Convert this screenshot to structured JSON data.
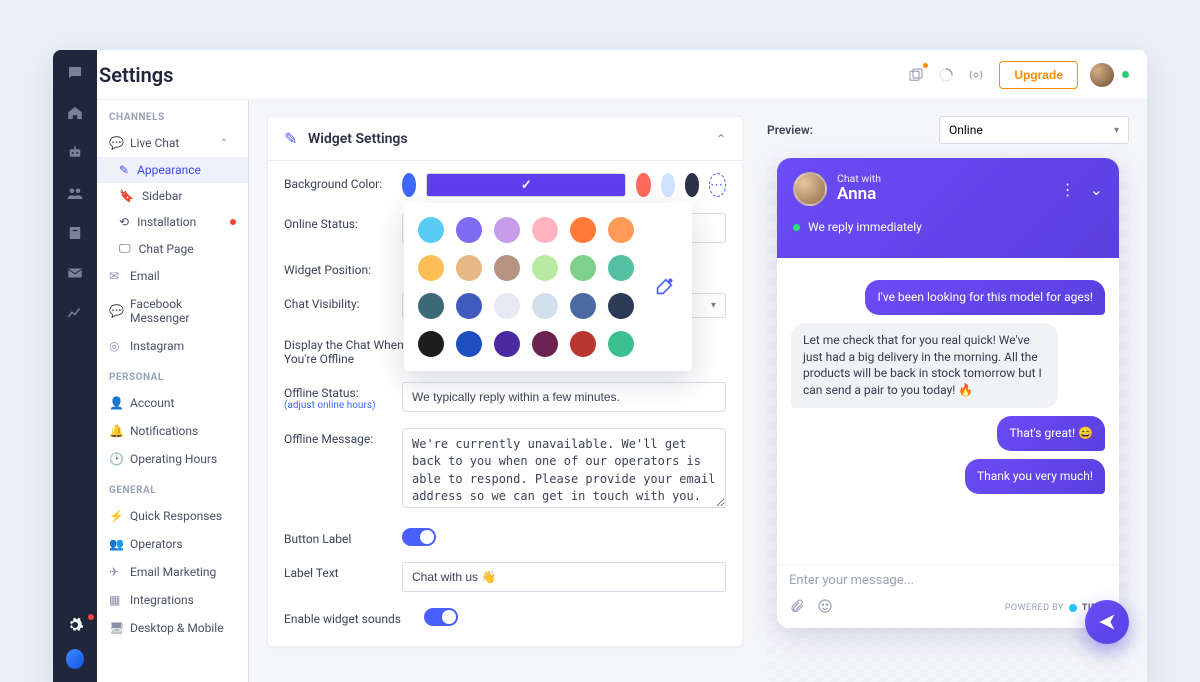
{
  "header": {
    "title": "Settings",
    "upgrade_label": "Upgrade"
  },
  "rail": {
    "icons": [
      "chat",
      "home",
      "bot",
      "people",
      "book",
      "mail",
      "chart"
    ]
  },
  "sidebar": {
    "sections": [
      {
        "label": "CHANNELS",
        "items": [
          {
            "label": "Live Chat",
            "icon": "chat-bubble",
            "expanded": true,
            "sub": [
              {
                "label": "Appearance",
                "icon": "brush",
                "active": true
              },
              {
                "label": "Sidebar",
                "icon": "bookmark"
              },
              {
                "label": "Installation",
                "icon": "link",
                "badge": true
              },
              {
                "label": "Chat Page",
                "icon": "monitor"
              }
            ]
          },
          {
            "label": "Email",
            "icon": "mail"
          },
          {
            "label": "Facebook Messenger",
            "icon": "messenger"
          },
          {
            "label": "Instagram",
            "icon": "instagram"
          }
        ]
      },
      {
        "label": "PERSONAL",
        "items": [
          {
            "label": "Account",
            "icon": "user"
          },
          {
            "label": "Notifications",
            "icon": "bell"
          },
          {
            "label": "Operating Hours",
            "icon": "clock"
          }
        ]
      },
      {
        "label": "GENERAL",
        "items": [
          {
            "label": "Quick Responses",
            "icon": "bolt"
          },
          {
            "label": "Operators",
            "icon": "people"
          },
          {
            "label": "Email Marketing",
            "icon": "send"
          },
          {
            "label": "Integrations",
            "icon": "grid"
          },
          {
            "label": "Desktop & Mobile",
            "icon": "devices"
          }
        ]
      }
    ]
  },
  "panel": {
    "title": "Widget Settings",
    "labels": {
      "bg_color": "Background Color:",
      "online_status": "Online Status:",
      "widget_position": "Widget Position:",
      "chat_visibility": "Chat Visibility:",
      "display_offline": "Display the Chat When You're Offline",
      "offline_status": "Offline Status:",
      "offline_status_hint": "(adjust online hours)",
      "offline_message": "Offline Message:",
      "button_label": "Button Label",
      "label_text": "Label Text",
      "enable_sounds": "Enable widget sounds"
    },
    "main_colors": [
      "#3d67ff",
      "#5f3fed",
      "#ff6a5c",
      "#cfe4ff",
      "#2b3245"
    ],
    "offline_status_value": "We typically reply within a few minutes.",
    "offline_message_value": "We're currently unavailable. We'll get back to you when one of our operators is able to respond. Please provide your email address so we can get in touch with you.",
    "label_text_value": "Chat with us 👋",
    "selected_color_index": 1,
    "popover_colors": [
      "#57cdf5",
      "#7d6cf1",
      "#c59bea",
      "#ffb3be",
      "#ff7a36",
      "#ff9a58",
      "#ffbe55",
      "#e7b784",
      "#b69283",
      "#b8eaa1",
      "#7fcf8d",
      "#52c0a1",
      "#3b6a76",
      "#3f5bbf",
      "#e6e9f3",
      "#d2e0ee",
      "#4a6aa0",
      "#2c3a56",
      "#1d1d1d",
      "#1f4fbf",
      "#4a2a9e",
      "#6a2450",
      "#b8382f",
      "#3bbf8f"
    ]
  },
  "preview": {
    "label": "Preview:",
    "status_select": "Online",
    "widget": {
      "subtitle": "Chat with",
      "operator_name": "Anna",
      "status_line": "We reply immediately",
      "messages": [
        {
          "from": "me",
          "text": "I've been looking for this model for ages!"
        },
        {
          "from": "op",
          "text": "Let me check that for you real quick! We've just had a big delivery in the morning. All the products will be back in stock tomorrow but I can send a pair to you today! 🔥"
        },
        {
          "from": "me",
          "text": "That's great! 😄"
        },
        {
          "from": "me",
          "text": "Thank you very much!"
        }
      ],
      "input_placeholder": "Enter your message...",
      "powered_by": "POWERED BY",
      "brand": "TIDIO"
    }
  }
}
